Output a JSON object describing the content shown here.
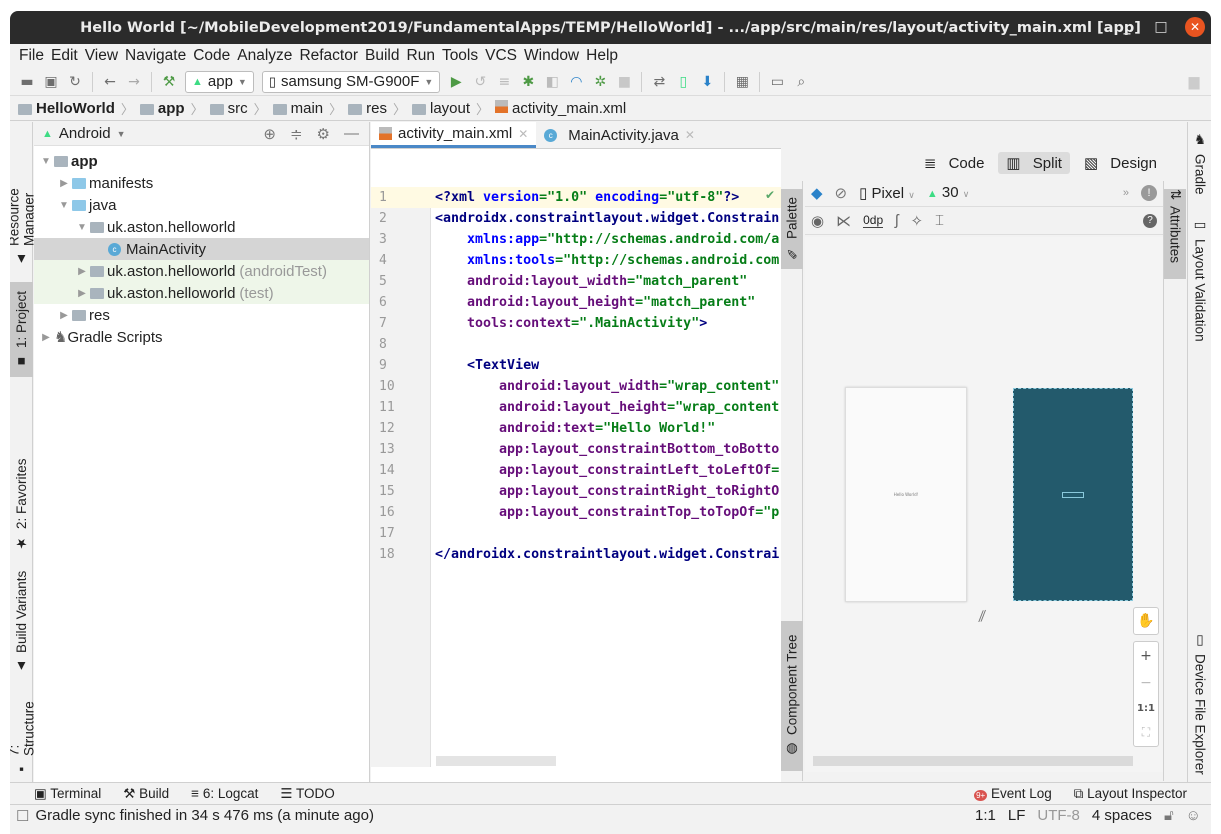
{
  "window": {
    "title": "Hello World [~/MobileDevelopment2019/FundamentalApps/TEMP/HelloWorld] - .../app/src/main/res/layout/activity_main.xml [app]",
    "controls": {
      "minimize": "_",
      "maximize": "□",
      "close": "✕"
    }
  },
  "menu": [
    "File",
    "Edit",
    "View",
    "Navigate",
    "Code",
    "Analyze",
    "Refactor",
    "Build",
    "Run",
    "Tools",
    "VCS",
    "Window",
    "Help"
  ],
  "toolbar": {
    "run_config": "app",
    "device": "samsung SM-G900F"
  },
  "breadcrumb": [
    "HelloWorld",
    "app",
    "src",
    "main",
    "res",
    "layout",
    "activity_main.xml"
  ],
  "left_tabs": {
    "resource_manager": "Resource Manager",
    "project": "1: Project",
    "favorites": "2: Favorites",
    "build_variants": "Build Variants",
    "structure": "7: Structure"
  },
  "project": {
    "view_mode": "Android",
    "tree": [
      {
        "label": "app",
        "suffix": "",
        "bold": true
      },
      {
        "label": "manifests",
        "suffix": ""
      },
      {
        "label": "java",
        "suffix": ""
      },
      {
        "label": "uk.aston.helloworld",
        "suffix": ""
      },
      {
        "label": "MainActivity",
        "suffix": ""
      },
      {
        "label": "uk.aston.helloworld",
        "suffix": "(androidTest)"
      },
      {
        "label": "uk.aston.helloworld",
        "suffix": "(test)"
      },
      {
        "label": "res",
        "suffix": ""
      },
      {
        "label": "Gradle Scripts",
        "suffix": ""
      }
    ]
  },
  "editor": {
    "tabs": [
      {
        "label": "activity_main.xml",
        "active": true
      },
      {
        "label": "MainActivity.java",
        "active": false
      }
    ],
    "lines": [
      {
        "n": "1",
        "parts": [
          [
            "c-tag",
            "<?xml "
          ],
          [
            "c-ns",
            "version"
          ],
          [
            "c-val",
            "=\"1.0\" "
          ],
          [
            "c-ns",
            "encoding"
          ],
          [
            "c-val",
            "=\"utf-8\""
          ],
          [
            "c-tag",
            "?>"
          ]
        ]
      },
      {
        "n": "2",
        "parts": [
          [
            "c-tag",
            "<androidx.constraintlayout.widget.Constrain"
          ]
        ]
      },
      {
        "n": "3",
        "parts": [
          [
            "",
            "    "
          ],
          [
            "c-ns",
            "xmlns:app"
          ],
          [
            "c-val",
            "=\"http://schemas.android.com/a"
          ]
        ]
      },
      {
        "n": "4",
        "parts": [
          [
            "",
            "    "
          ],
          [
            "c-ns",
            "xmlns:tools"
          ],
          [
            "c-val",
            "=\"http://schemas.android.com"
          ]
        ]
      },
      {
        "n": "5",
        "parts": [
          [
            "",
            "    "
          ],
          [
            "c-attr",
            "android:layout_width"
          ],
          [
            "c-val",
            "=\"match_parent\""
          ]
        ]
      },
      {
        "n": "6",
        "parts": [
          [
            "",
            "    "
          ],
          [
            "c-attr",
            "android:layout_height"
          ],
          [
            "c-val",
            "=\"match_parent\""
          ]
        ]
      },
      {
        "n": "7",
        "parts": [
          [
            "",
            "    "
          ],
          [
            "c-attr",
            "tools:context"
          ],
          [
            "c-val",
            "=\".MainActivity\""
          ],
          [
            "c-tag",
            ">"
          ]
        ]
      },
      {
        "n": "8",
        "parts": []
      },
      {
        "n": "9",
        "parts": [
          [
            "",
            "    "
          ],
          [
            "c-tag",
            "<TextView"
          ]
        ]
      },
      {
        "n": "10",
        "parts": [
          [
            "",
            "        "
          ],
          [
            "c-attr",
            "android:layout_width"
          ],
          [
            "c-val",
            "=\"wrap_content\""
          ]
        ]
      },
      {
        "n": "11",
        "parts": [
          [
            "",
            "        "
          ],
          [
            "c-attr",
            "android:layout_height"
          ],
          [
            "c-val",
            "=\"wrap_content"
          ]
        ]
      },
      {
        "n": "12",
        "parts": [
          [
            "",
            "        "
          ],
          [
            "c-attr",
            "android:text"
          ],
          [
            "c-val",
            "=\"Hello World!\""
          ]
        ]
      },
      {
        "n": "13",
        "parts": [
          [
            "",
            "        "
          ],
          [
            "c-attr",
            "app:layout_constraintBottom_toBotto"
          ]
        ]
      },
      {
        "n": "14",
        "parts": [
          [
            "",
            "        "
          ],
          [
            "c-attr",
            "app:layout_constraintLeft_toLeftOf"
          ],
          [
            "c-val",
            "="
          ]
        ]
      },
      {
        "n": "15",
        "parts": [
          [
            "",
            "        "
          ],
          [
            "c-attr",
            "app:layout_constraintRight_toRightO"
          ]
        ]
      },
      {
        "n": "16",
        "parts": [
          [
            "",
            "        "
          ],
          [
            "c-attr",
            "app:layout_constraintTop_toTopOf"
          ],
          [
            "c-val",
            "=\"p"
          ]
        ]
      },
      {
        "n": "17",
        "parts": []
      },
      {
        "n": "18",
        "parts": [
          [
            "c-tag",
            "</androidx.constraintlayout.widget.Constrai"
          ]
        ]
      }
    ]
  },
  "design": {
    "modes": {
      "code": "Code",
      "split": "Split",
      "design": "Design"
    },
    "device": "Pixel",
    "api": "30",
    "margin": "0dp",
    "preview_text": "Hello World!",
    "zoom_reset": "1:1",
    "palette": "Palette",
    "component_tree": "Component Tree",
    "attributes": "Attributes",
    "blueprint_color": "#235a6c"
  },
  "right_tabs": {
    "gradle": "Gradle",
    "layout_validation": "Layout Validation",
    "device_file_explorer": "Device File Explorer"
  },
  "bottom_tools": {
    "terminal": "Terminal",
    "build": "Build",
    "logcat": "6: Logcat",
    "todo": "TODO",
    "event_log": "Event Log",
    "event_badge": "9+",
    "layout_inspector": "Layout Inspector"
  },
  "status": {
    "message": "Gradle sync finished in 34 s 476 ms (a minute ago)",
    "position": "1:1",
    "line_sep": "LF",
    "encoding": "UTF-8",
    "indent": "4 spaces"
  }
}
